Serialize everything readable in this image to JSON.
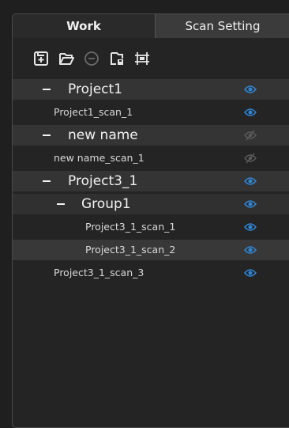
{
  "tabs": [
    {
      "label": "Work",
      "active": true
    },
    {
      "label": "Scan Setting",
      "active": false
    }
  ],
  "toolbar": {
    "icons": [
      "add-project-icon",
      "open-folder-icon",
      "remove-icon",
      "save-file-icon",
      "group-icon"
    ]
  },
  "tree": [
    {
      "label": "Project1",
      "level": "project",
      "visible": true
    },
    {
      "label": "Project1_scan_1",
      "level": "scan",
      "visible": true
    },
    {
      "label": "new name",
      "level": "project",
      "visible": false
    },
    {
      "label": "new name_scan_1",
      "level": "scan",
      "visible": false
    },
    {
      "label": "Project3_1",
      "level": "project",
      "visible": true
    },
    {
      "label": "Group1",
      "level": "group",
      "visible": true
    },
    {
      "label": "Project3_1_scan_1",
      "level": "group-scan",
      "visible": true
    },
    {
      "label": "Project3_1_scan_2",
      "level": "group-scan",
      "visible": true,
      "selected": true
    },
    {
      "label": "Project3_1_scan_3",
      "level": "scan",
      "visible": true
    }
  ],
  "colors": {
    "eye_visible": "#2f86d6",
    "eye_hidden": "#5a5a5a"
  }
}
